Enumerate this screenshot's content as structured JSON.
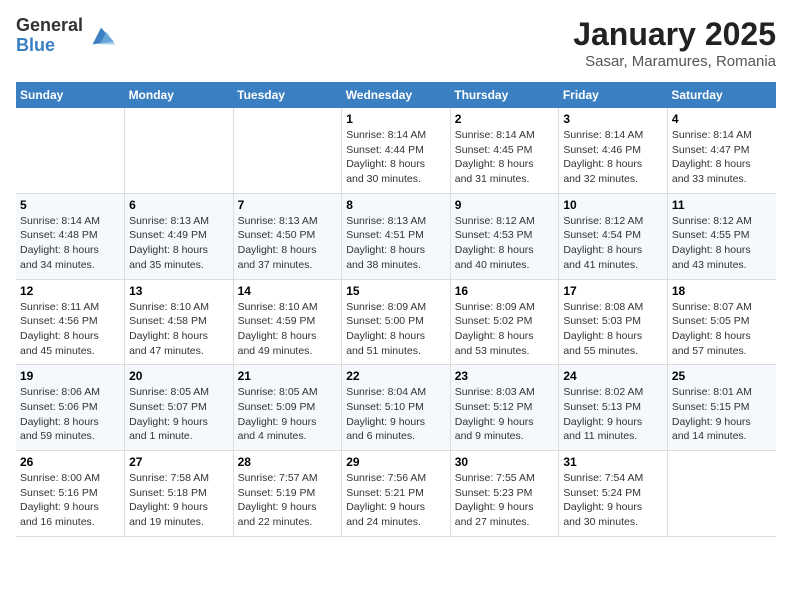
{
  "header": {
    "logo_general": "General",
    "logo_blue": "Blue",
    "title": "January 2025",
    "subtitle": "Sasar, Maramures, Romania"
  },
  "weekdays": [
    "Sunday",
    "Monday",
    "Tuesday",
    "Wednesday",
    "Thursday",
    "Friday",
    "Saturday"
  ],
  "weeks": [
    [
      {
        "day": "",
        "info": ""
      },
      {
        "day": "",
        "info": ""
      },
      {
        "day": "",
        "info": ""
      },
      {
        "day": "1",
        "info": "Sunrise: 8:14 AM\nSunset: 4:44 PM\nDaylight: 8 hours\nand 30 minutes."
      },
      {
        "day": "2",
        "info": "Sunrise: 8:14 AM\nSunset: 4:45 PM\nDaylight: 8 hours\nand 31 minutes."
      },
      {
        "day": "3",
        "info": "Sunrise: 8:14 AM\nSunset: 4:46 PM\nDaylight: 8 hours\nand 32 minutes."
      },
      {
        "day": "4",
        "info": "Sunrise: 8:14 AM\nSunset: 4:47 PM\nDaylight: 8 hours\nand 33 minutes."
      }
    ],
    [
      {
        "day": "5",
        "info": "Sunrise: 8:14 AM\nSunset: 4:48 PM\nDaylight: 8 hours\nand 34 minutes."
      },
      {
        "day": "6",
        "info": "Sunrise: 8:13 AM\nSunset: 4:49 PM\nDaylight: 8 hours\nand 35 minutes."
      },
      {
        "day": "7",
        "info": "Sunrise: 8:13 AM\nSunset: 4:50 PM\nDaylight: 8 hours\nand 37 minutes."
      },
      {
        "day": "8",
        "info": "Sunrise: 8:13 AM\nSunset: 4:51 PM\nDaylight: 8 hours\nand 38 minutes."
      },
      {
        "day": "9",
        "info": "Sunrise: 8:12 AM\nSunset: 4:53 PM\nDaylight: 8 hours\nand 40 minutes."
      },
      {
        "day": "10",
        "info": "Sunrise: 8:12 AM\nSunset: 4:54 PM\nDaylight: 8 hours\nand 41 minutes."
      },
      {
        "day": "11",
        "info": "Sunrise: 8:12 AM\nSunset: 4:55 PM\nDaylight: 8 hours\nand 43 minutes."
      }
    ],
    [
      {
        "day": "12",
        "info": "Sunrise: 8:11 AM\nSunset: 4:56 PM\nDaylight: 8 hours\nand 45 minutes."
      },
      {
        "day": "13",
        "info": "Sunrise: 8:10 AM\nSunset: 4:58 PM\nDaylight: 8 hours\nand 47 minutes."
      },
      {
        "day": "14",
        "info": "Sunrise: 8:10 AM\nSunset: 4:59 PM\nDaylight: 8 hours\nand 49 minutes."
      },
      {
        "day": "15",
        "info": "Sunrise: 8:09 AM\nSunset: 5:00 PM\nDaylight: 8 hours\nand 51 minutes."
      },
      {
        "day": "16",
        "info": "Sunrise: 8:09 AM\nSunset: 5:02 PM\nDaylight: 8 hours\nand 53 minutes."
      },
      {
        "day": "17",
        "info": "Sunrise: 8:08 AM\nSunset: 5:03 PM\nDaylight: 8 hours\nand 55 minutes."
      },
      {
        "day": "18",
        "info": "Sunrise: 8:07 AM\nSunset: 5:05 PM\nDaylight: 8 hours\nand 57 minutes."
      }
    ],
    [
      {
        "day": "19",
        "info": "Sunrise: 8:06 AM\nSunset: 5:06 PM\nDaylight: 8 hours\nand 59 minutes."
      },
      {
        "day": "20",
        "info": "Sunrise: 8:05 AM\nSunset: 5:07 PM\nDaylight: 9 hours\nand 1 minute."
      },
      {
        "day": "21",
        "info": "Sunrise: 8:05 AM\nSunset: 5:09 PM\nDaylight: 9 hours\nand 4 minutes."
      },
      {
        "day": "22",
        "info": "Sunrise: 8:04 AM\nSunset: 5:10 PM\nDaylight: 9 hours\nand 6 minutes."
      },
      {
        "day": "23",
        "info": "Sunrise: 8:03 AM\nSunset: 5:12 PM\nDaylight: 9 hours\nand 9 minutes."
      },
      {
        "day": "24",
        "info": "Sunrise: 8:02 AM\nSunset: 5:13 PM\nDaylight: 9 hours\nand 11 minutes."
      },
      {
        "day": "25",
        "info": "Sunrise: 8:01 AM\nSunset: 5:15 PM\nDaylight: 9 hours\nand 14 minutes."
      }
    ],
    [
      {
        "day": "26",
        "info": "Sunrise: 8:00 AM\nSunset: 5:16 PM\nDaylight: 9 hours\nand 16 minutes."
      },
      {
        "day": "27",
        "info": "Sunrise: 7:58 AM\nSunset: 5:18 PM\nDaylight: 9 hours\nand 19 minutes."
      },
      {
        "day": "28",
        "info": "Sunrise: 7:57 AM\nSunset: 5:19 PM\nDaylight: 9 hours\nand 22 minutes."
      },
      {
        "day": "29",
        "info": "Sunrise: 7:56 AM\nSunset: 5:21 PM\nDaylight: 9 hours\nand 24 minutes."
      },
      {
        "day": "30",
        "info": "Sunrise: 7:55 AM\nSunset: 5:23 PM\nDaylight: 9 hours\nand 27 minutes."
      },
      {
        "day": "31",
        "info": "Sunrise: 7:54 AM\nSunset: 5:24 PM\nDaylight: 9 hours\nand 30 minutes."
      },
      {
        "day": "",
        "info": ""
      }
    ]
  ]
}
